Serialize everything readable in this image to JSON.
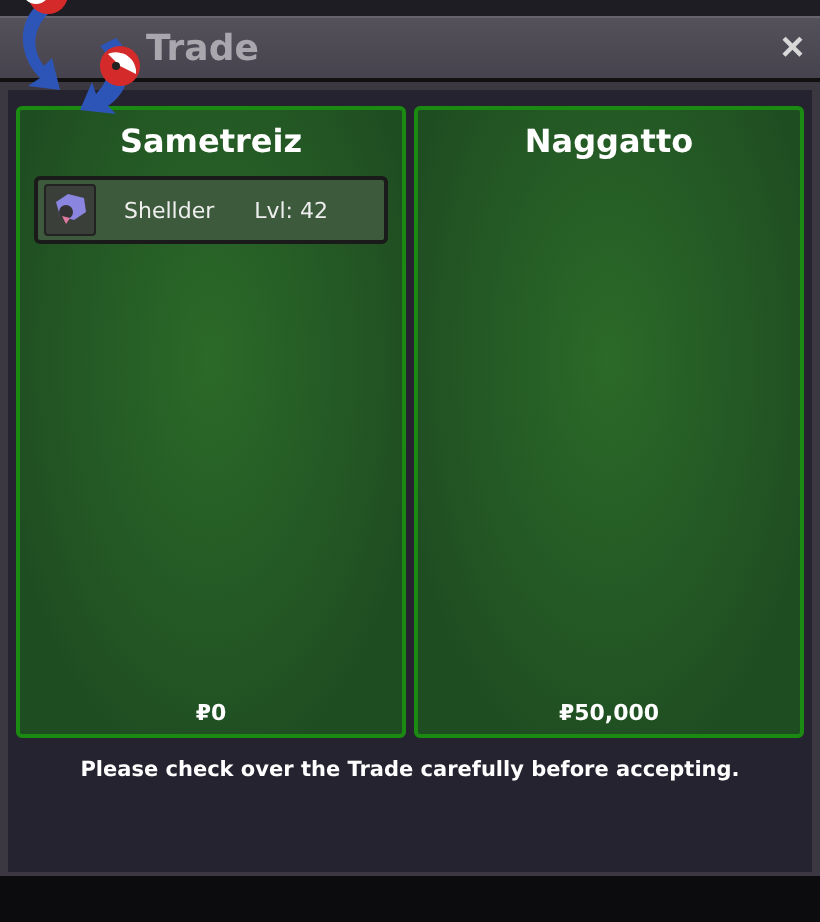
{
  "window": {
    "title": "Trade",
    "close": "×"
  },
  "traders": [
    {
      "name": "Sametreiz",
      "items": [
        {
          "name": "Shellder",
          "level": "Lvl: 42"
        }
      ],
      "money": "₽0"
    },
    {
      "name": "Naggatto",
      "money": "₽50,000"
    }
  ],
  "notice": "Please check over the Trade carefully before accepting."
}
